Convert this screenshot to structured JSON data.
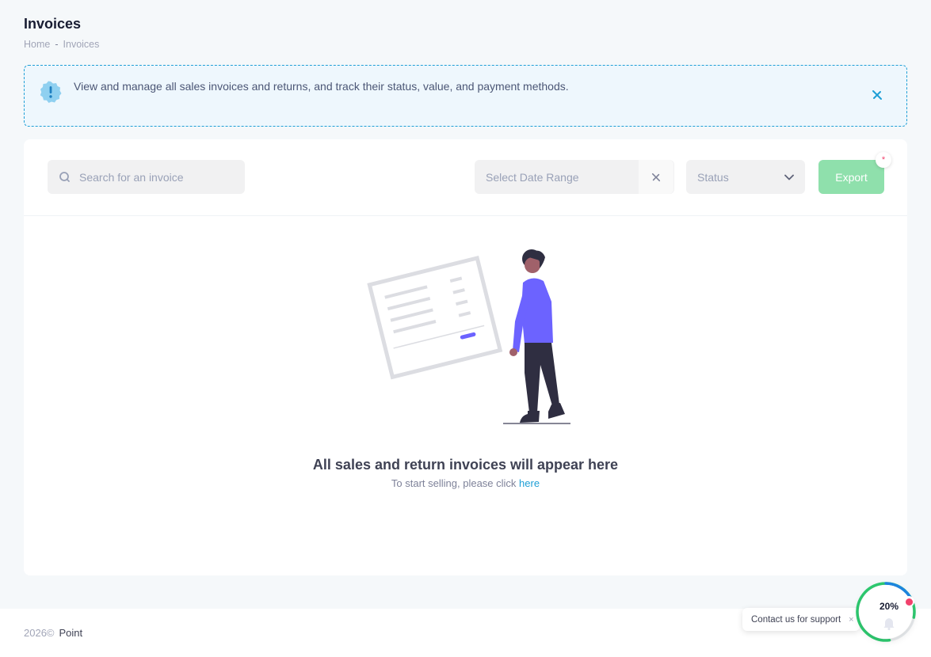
{
  "page": {
    "title": "Invoices",
    "breadcrumb": {
      "home": "Home",
      "separator": "-",
      "current": "Invoices"
    }
  },
  "notice": {
    "text": "View and manage all sales invoices and returns, and track their status, value, and payment methods.",
    "icon": "info-badge-icon",
    "accent_color": "#1e9fd6"
  },
  "toolbar": {
    "search_placeholder": "Search for an invoice",
    "date_range_placeholder": "Select Date Range",
    "status_label": "Status",
    "export_label": "Export",
    "required_mark": "*",
    "export_color": "#8fe0ac"
  },
  "empty_state": {
    "title": "All sales and return invoices will appear here",
    "subtitle_prefix": "To start selling, please click",
    "link_text": "here"
  },
  "footer": {
    "year": "2026©",
    "brand": "Point"
  },
  "support": {
    "label": "Contact us for support",
    "close": "×"
  },
  "progress": {
    "value": 0.2,
    "text": "20%"
  }
}
